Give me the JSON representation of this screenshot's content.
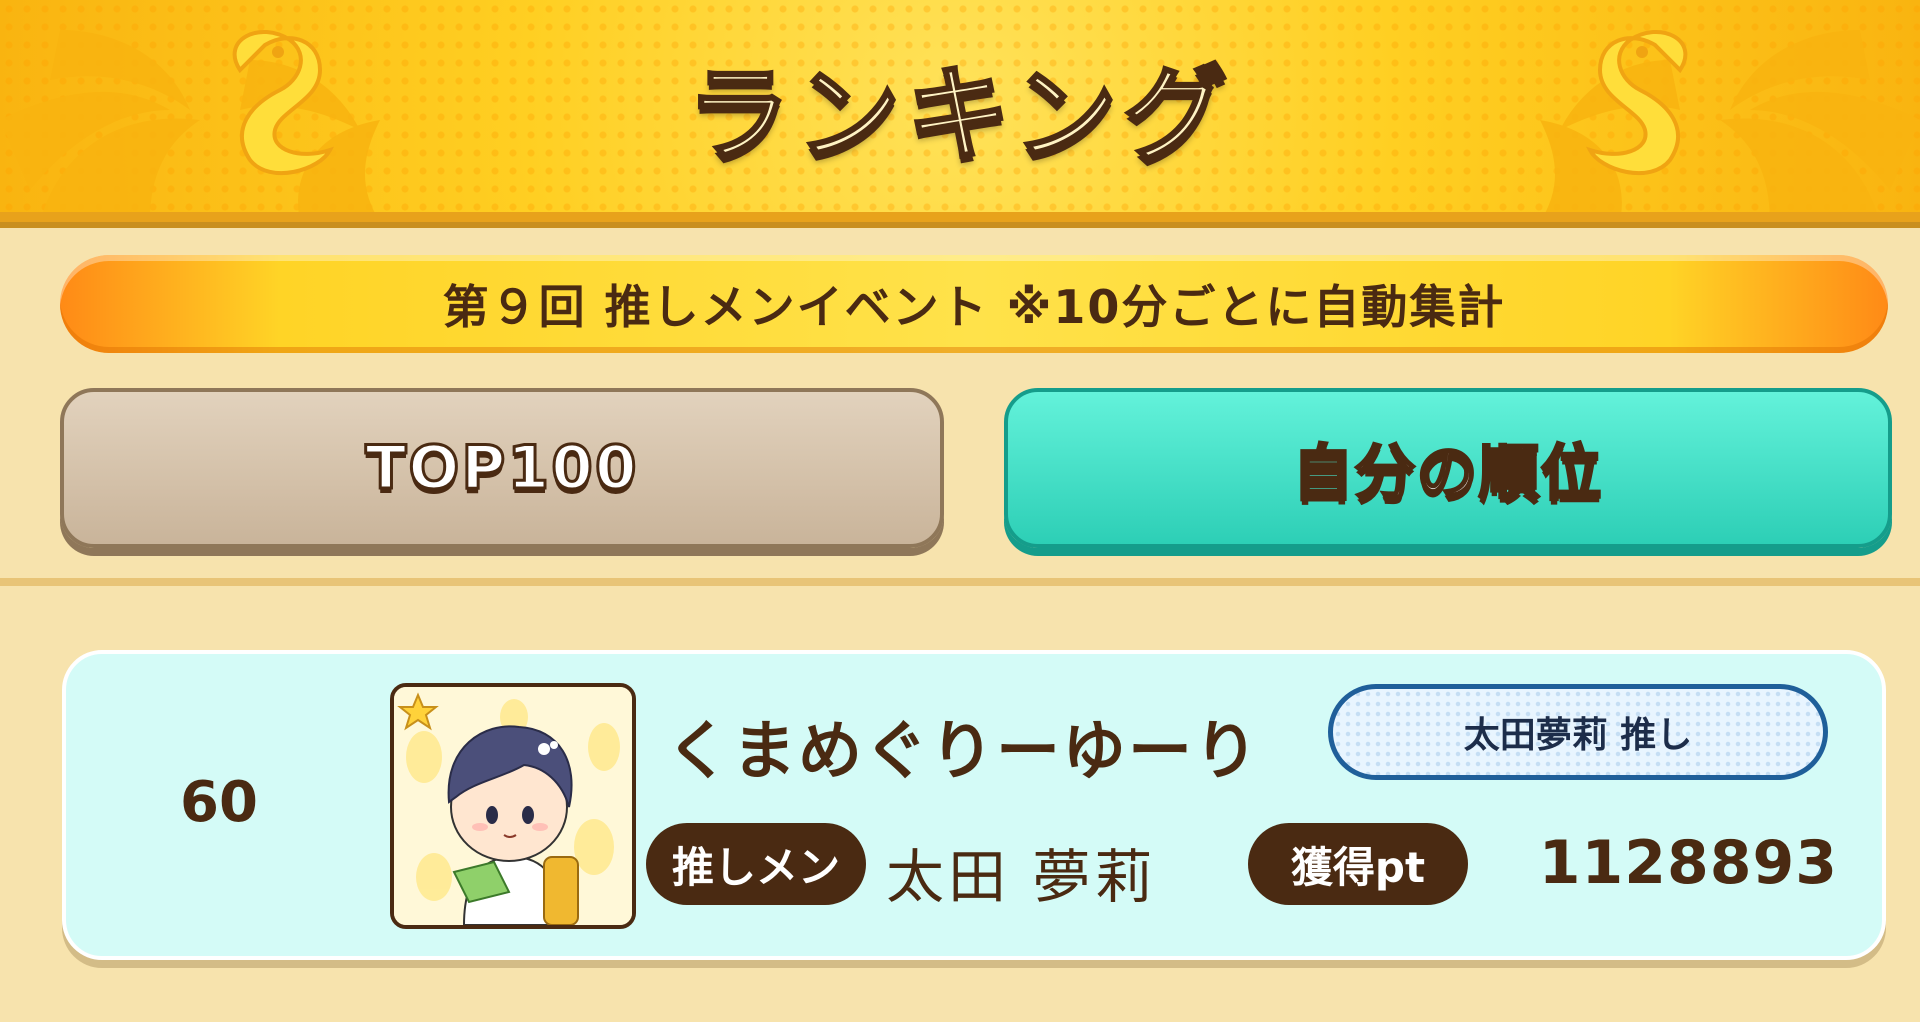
{
  "header": {
    "title": "ランキング"
  },
  "banner": {
    "text": "第９回 推しメンイベント ※10分ごとに自動集計"
  },
  "tabs": [
    {
      "label": "TOP100",
      "selected": false
    },
    {
      "label": "自分の順位",
      "selected": true
    }
  ],
  "entry": {
    "rank": "60",
    "player_name": "くまめぐりーゆーり",
    "oshi_badge": "太田夢莉 推し",
    "oshimen_label": "推しメン",
    "oshimen_name": "太田 夢莉",
    "points_label": "獲得pt",
    "points": "1128893"
  },
  "colors": {
    "header_gold": "#ffcf22",
    "dark_brown": "#4a2a12",
    "tab_selected": "#2dcfb6",
    "tab_unselected": "#c9b49a",
    "card_bg": "#d4fbf7"
  }
}
